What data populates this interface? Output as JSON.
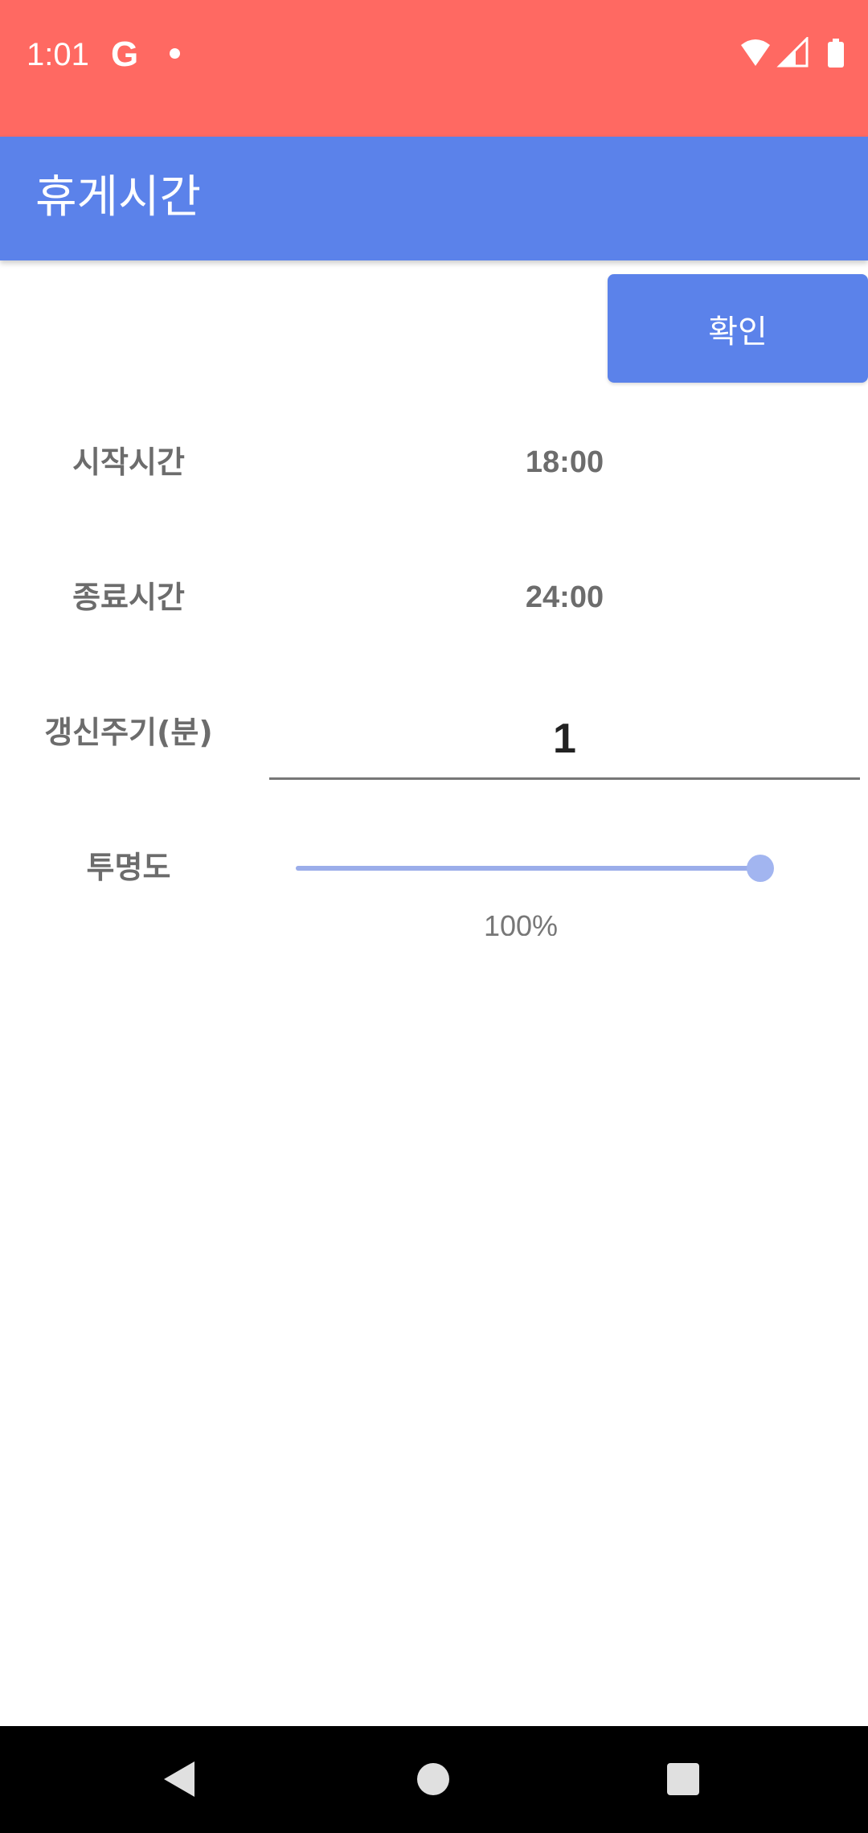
{
  "status_bar": {
    "time": "1:01",
    "google_glyph": "G",
    "icons": [
      "wifi-icon",
      "signal-icon",
      "battery-icon"
    ]
  },
  "app_bar": {
    "title": "휴게시간"
  },
  "confirm_button": {
    "label": "확인"
  },
  "form": {
    "start_time": {
      "label": "시작시간",
      "value": "18:00"
    },
    "end_time": {
      "label": "종료시간",
      "value": "24:00"
    },
    "refresh_interval": {
      "label": "갱신주기(분)",
      "value": "1"
    },
    "opacity": {
      "label": "투명도",
      "value_text": "100%",
      "percent": 100
    }
  },
  "nav_bar": {
    "icons": [
      "back-icon",
      "home-icon",
      "recents-icon"
    ]
  },
  "colors": {
    "status_bar": "#ff6962",
    "accent": "#5b82ea",
    "label_text": "#6c6c6c",
    "slider_thumb": "#a2b5f0"
  }
}
